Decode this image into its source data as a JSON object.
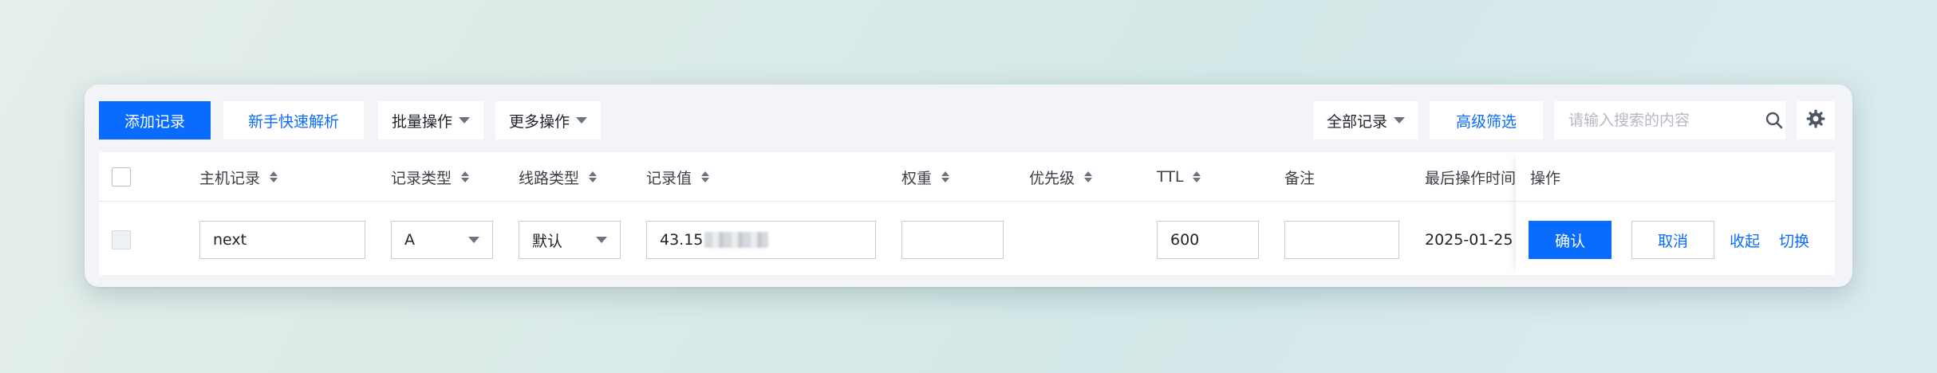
{
  "toolbar": {
    "add_record": "添加记录",
    "quick_resolve": "新手快速解析",
    "batch_ops": "批量操作",
    "more_ops": "更多操作",
    "all_records": "全部记录",
    "advanced_filter": "高级筛选",
    "search_placeholder": "请输入搜索的内容"
  },
  "table": {
    "columns": {
      "host": "主机记录",
      "type": "记录类型",
      "line": "线路类型",
      "value": "记录值",
      "weight": "权重",
      "priority": "优先级",
      "ttl": "TTL",
      "remark": "备注",
      "last_op_time": "最后操作时间",
      "actions": "操作"
    },
    "edit_row": {
      "host": "next",
      "type": "A",
      "line": "默认",
      "value_prefix": "43.15",
      "weight": "",
      "ttl": "600",
      "remark": "",
      "last_op_time": "2025-01-25",
      "confirm": "确认",
      "cancel": "取消",
      "collapse": "收起",
      "switch": "切换"
    }
  },
  "colors": {
    "primary": "#0a6cff",
    "panel_bg": "#f2f4f7"
  }
}
